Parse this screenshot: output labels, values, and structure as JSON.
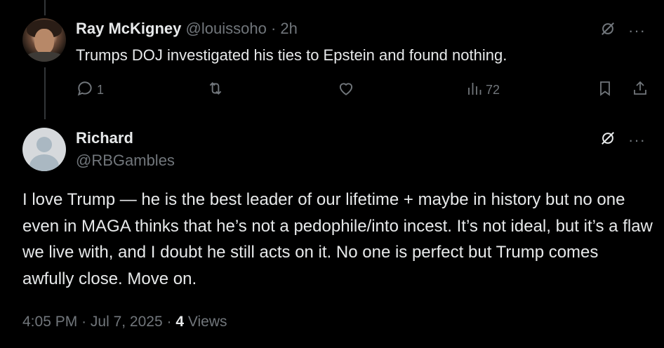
{
  "reply": {
    "name": "Ray McKigney",
    "handle": "@louissoho",
    "separator": "·",
    "time": "2h",
    "text": "Trumps DOJ investigated his ties to Epstein and found nothing.",
    "reply_count": "1",
    "retweet_count": "",
    "like_count": "",
    "view_count": "72",
    "more_label": "···"
  },
  "main": {
    "name": "Richard",
    "handle": "@RBGambles",
    "text": "I love Trump — he is the best leader of our lifetime + maybe in history but no one even in MAGA thinks that he’s not a pedophile/into incest.  It’s not ideal, but it’s a flaw we live with, and I doubt he still acts on it.  No one is perfect but Trump comes awfully close. Move on.",
    "time": "4:05 PM",
    "date": "Jul 7, 2025",
    "sep1": "·",
    "sep2": "·",
    "views_count": "4",
    "views_label": "Views",
    "more_label": "···"
  },
  "icons": [
    "grok-icon",
    "more-icon",
    "reply-icon",
    "retweet-icon",
    "like-icon",
    "views-icon",
    "bookmark-icon",
    "share-icon"
  ],
  "colors": {
    "background": "#000000",
    "text": "#e7e9ea",
    "muted": "#71767b",
    "thread_line": "#333639"
  }
}
